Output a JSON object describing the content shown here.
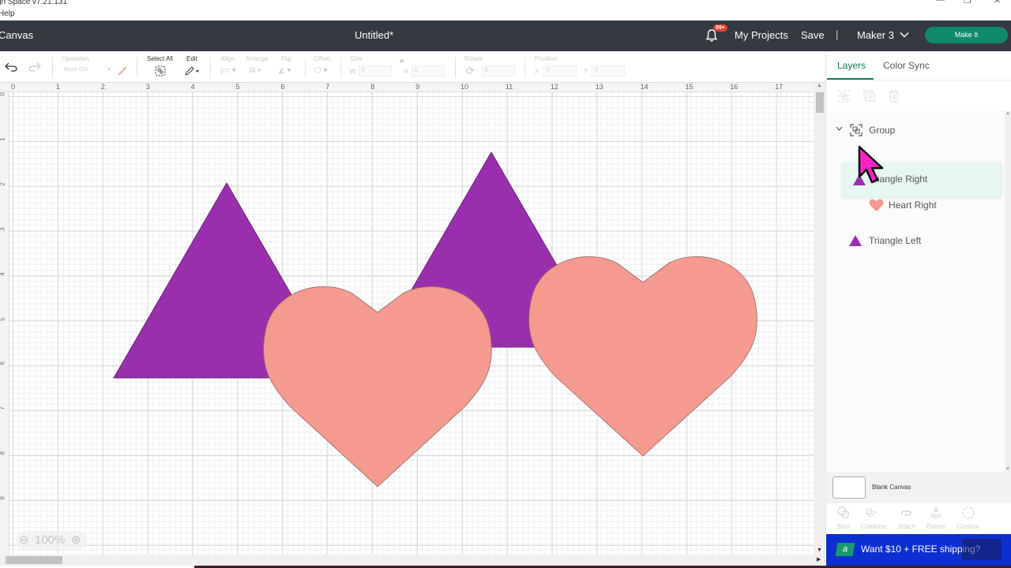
{
  "window": {
    "app_title": "gn Space  v7.21.131",
    "menu_help": "Help",
    "controls": [
      "minimize",
      "restore",
      "close"
    ]
  },
  "header": {
    "breadcrumb": "Canvas",
    "doc_title": "Untitled*",
    "notification_badge": "99+",
    "my_projects": "My Projects",
    "save": "Save",
    "separator": "|",
    "machine": "Maker 3",
    "make_it": "Make It",
    "colors": {
      "bar": "#343a40",
      "make_it": "#0e8a6a",
      "badge": "#e53d2e"
    }
  },
  "toolbar": {
    "operation_label": "Operation",
    "operation_value": "Basic Cut",
    "select_all": "Select All",
    "edit": "Edit",
    "align": "Align",
    "arrange": "Arrange",
    "flip": "Flip",
    "offset": "Offset",
    "size": "Size",
    "w_label": "W",
    "w_value": "0",
    "h_label": "H",
    "h_value": "0",
    "rotate": "Rotate",
    "rotate_value": "0",
    "position": "Position",
    "x_label": "X",
    "x_value": "0",
    "y_label": "Y",
    "y_value": "0"
  },
  "rulers": {
    "horizontal": [
      "0",
      "1",
      "2",
      "3",
      "4",
      "5",
      "6",
      "7",
      "8",
      "9",
      "10",
      "11",
      "12",
      "13",
      "14",
      "15",
      "16",
      "17"
    ],
    "vertical": [
      "0",
      "1",
      "2",
      "3",
      "4",
      "5",
      "6",
      "7",
      "8",
      "9"
    ]
  },
  "canvas": {
    "zoom": "100%",
    "shapes": [
      {
        "name": "Triangle Left",
        "type": "triangle",
        "color": "#9a2fae"
      },
      {
        "name": "Triangle Right",
        "type": "triangle",
        "color": "#9a2fae"
      },
      {
        "name": "Heart Left",
        "type": "heart",
        "color": "#f49a8f"
      },
      {
        "name": "Heart Right",
        "type": "heart",
        "color": "#f49a8f"
      }
    ]
  },
  "layers_panel": {
    "tabs": [
      {
        "label": "Layers",
        "active": true
      },
      {
        "label": "Color Sync",
        "active": false
      }
    ],
    "group_label": "Group",
    "items": [
      {
        "label": "Triangle Right",
        "icon": "triangle-icon",
        "selected": true
      },
      {
        "label": "Heart Right",
        "icon": "heart-icon",
        "selected": false
      },
      {
        "label": "Triangle Left",
        "icon": "triangle-icon",
        "selected": false
      }
    ],
    "blank_canvas": "Blank Canvas",
    "bottom_tools": [
      "Slice",
      "Combine",
      "Attach",
      "Flatten",
      "Contour"
    ],
    "accent": "#0e7a5f"
  },
  "promo": {
    "logo": "a",
    "message": "Want $10 + FREE shipping?"
  }
}
